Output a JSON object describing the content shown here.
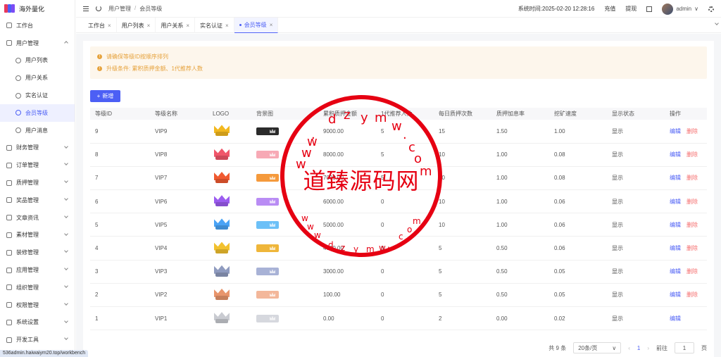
{
  "app": {
    "title": "海外量化",
    "logo_colors": [
      "#e8385d",
      "#4c5ff5",
      "#7b4cf5"
    ]
  },
  "sidebar": {
    "items": [
      {
        "label": "工作台",
        "icon": "monitor-icon",
        "expand": ""
      },
      {
        "label": "用户管理",
        "icon": "user-icon",
        "expand": "up"
      },
      {
        "label": "用户列表",
        "icon": "user-icon",
        "sub": true
      },
      {
        "label": "用户关系",
        "icon": "users-icon",
        "sub": true
      },
      {
        "label": "实名认证",
        "icon": "id-card-icon",
        "sub": true
      },
      {
        "label": "会员等级",
        "icon": "rocket-icon",
        "sub": true,
        "active": true
      },
      {
        "label": "用户消息",
        "icon": "chat-icon",
        "sub": true
      },
      {
        "label": "财务管理",
        "icon": "wallet-icon",
        "expand": "down"
      },
      {
        "label": "订单管理",
        "icon": "order-icon",
        "expand": "down"
      },
      {
        "label": "质押管理",
        "icon": "stake-icon",
        "expand": "down"
      },
      {
        "label": "奖品管理",
        "icon": "gift-icon",
        "expand": "down"
      },
      {
        "label": "文章资讯",
        "icon": "article-icon",
        "expand": "down"
      },
      {
        "label": "素材管理",
        "icon": "image-icon",
        "expand": "down"
      },
      {
        "label": "装修管理",
        "icon": "decor-icon",
        "expand": "down"
      },
      {
        "label": "应用管理",
        "icon": "app-icon",
        "expand": "down"
      },
      {
        "label": "组织管理",
        "icon": "org-icon",
        "expand": "down"
      },
      {
        "label": "权限管理",
        "icon": "lock-icon",
        "expand": "down"
      },
      {
        "label": "系统设置",
        "icon": "gear-icon",
        "expand": "down"
      },
      {
        "label": "开发工具",
        "icon": "tool-icon",
        "expand": "down"
      }
    ]
  },
  "header": {
    "breadcrumb": [
      "用户管理",
      "会员等级"
    ],
    "system_time_label": "系统时间:",
    "system_time": "2025-02-20 12:28:16",
    "recharge": "充值",
    "withdraw": "提现",
    "username": "admin"
  },
  "tabs": [
    {
      "label": "工作台",
      "active": false
    },
    {
      "label": "用户列表",
      "active": false
    },
    {
      "label": "用户关系",
      "active": false
    },
    {
      "label": "实名认证",
      "active": false
    },
    {
      "label": "会员等级",
      "active": true
    }
  ],
  "alerts": [
    "请确保等级ID按顺序排列",
    "升级条件: 累积质押金额、1代推荐人数"
  ],
  "add_button": "新增",
  "table": {
    "columns": [
      "等级ID",
      "等级名称",
      "LOGO",
      "背景图",
      "累积质押金额",
      "1代推荐人数",
      "每日质押次数",
      "质押加息率",
      "挖矿速度",
      "显示状态",
      "操作"
    ],
    "rows": [
      {
        "id": "9",
        "name": "VIP9",
        "crown": "#f2b81f",
        "bg": "#2b2b2b",
        "amount": "9000.00",
        "refs": "5",
        "daily": "15",
        "rate": "1.50",
        "speed": "1.00",
        "status": "显示",
        "deletable": true
      },
      {
        "id": "8",
        "name": "VIP8",
        "crown": "#f0566a",
        "bg": "#f7a9b5",
        "amount": "8000.00",
        "refs": "5",
        "daily": "10",
        "rate": "1.00",
        "speed": "0.08",
        "status": "显示",
        "deletable": true
      },
      {
        "id": "7",
        "name": "VIP7",
        "crown": "#f05a30",
        "bg": "#f59a3c",
        "amount": "7000.00",
        "refs": "5",
        "daily": "10",
        "rate": "1.00",
        "speed": "0.08",
        "status": "显示",
        "deletable": true
      },
      {
        "id": "6",
        "name": "VIP6",
        "crown": "#9c5cf0",
        "bg": "#b98cf4",
        "amount": "6000.00",
        "refs": "0",
        "daily": "10",
        "rate": "1.00",
        "speed": "0.06",
        "status": "显示",
        "deletable": true
      },
      {
        "id": "5",
        "name": "VIP5",
        "crown": "#4aa3f5",
        "bg": "#6cc0f7",
        "amount": "5000.00",
        "refs": "0",
        "daily": "10",
        "rate": "1.00",
        "speed": "0.06",
        "status": "显示",
        "deletable": true
      },
      {
        "id": "4",
        "name": "VIP4",
        "crown": "#f2c12e",
        "bg": "#efb63a",
        "amount": "4000.00",
        "refs": "0",
        "daily": "5",
        "rate": "0.50",
        "speed": "0.06",
        "status": "显示",
        "deletable": true
      },
      {
        "id": "3",
        "name": "VIP3",
        "crown": "#8f9bbf",
        "bg": "#a8b2d6",
        "amount": "3000.00",
        "refs": "0",
        "daily": "5",
        "rate": "0.50",
        "speed": "0.05",
        "status": "显示",
        "deletable": true
      },
      {
        "id": "2",
        "name": "VIP2",
        "crown": "#e8956c",
        "bg": "#f3b79a",
        "amount": "100.00",
        "refs": "0",
        "daily": "5",
        "rate": "0.50",
        "speed": "0.05",
        "status": "显示",
        "deletable": true
      },
      {
        "id": "1",
        "name": "VIP1",
        "crown": "#c9cbd1",
        "bg": "#d6d8de",
        "amount": "0.00",
        "refs": "0",
        "daily": "2",
        "rate": "0.00",
        "speed": "0.02",
        "status": "显示",
        "deletable": false
      }
    ],
    "edit_label": "编辑",
    "delete_label": "删除"
  },
  "pagination": {
    "total": "共 9 条",
    "page_size": "20条/页",
    "current": "1",
    "goto_label": "前往",
    "goto_value": "1",
    "page_suffix": "页"
  },
  "statusbar": {
    "url": "536admin.haiwaiym20.top/workbench"
  },
  "watermark": {
    "text": "道臻源码网",
    "url_letters": [
      "w",
      "w",
      "w",
      ".",
      "d",
      "z",
      "y",
      "m",
      "w",
      ".",
      "c",
      "o",
      "m"
    ]
  }
}
